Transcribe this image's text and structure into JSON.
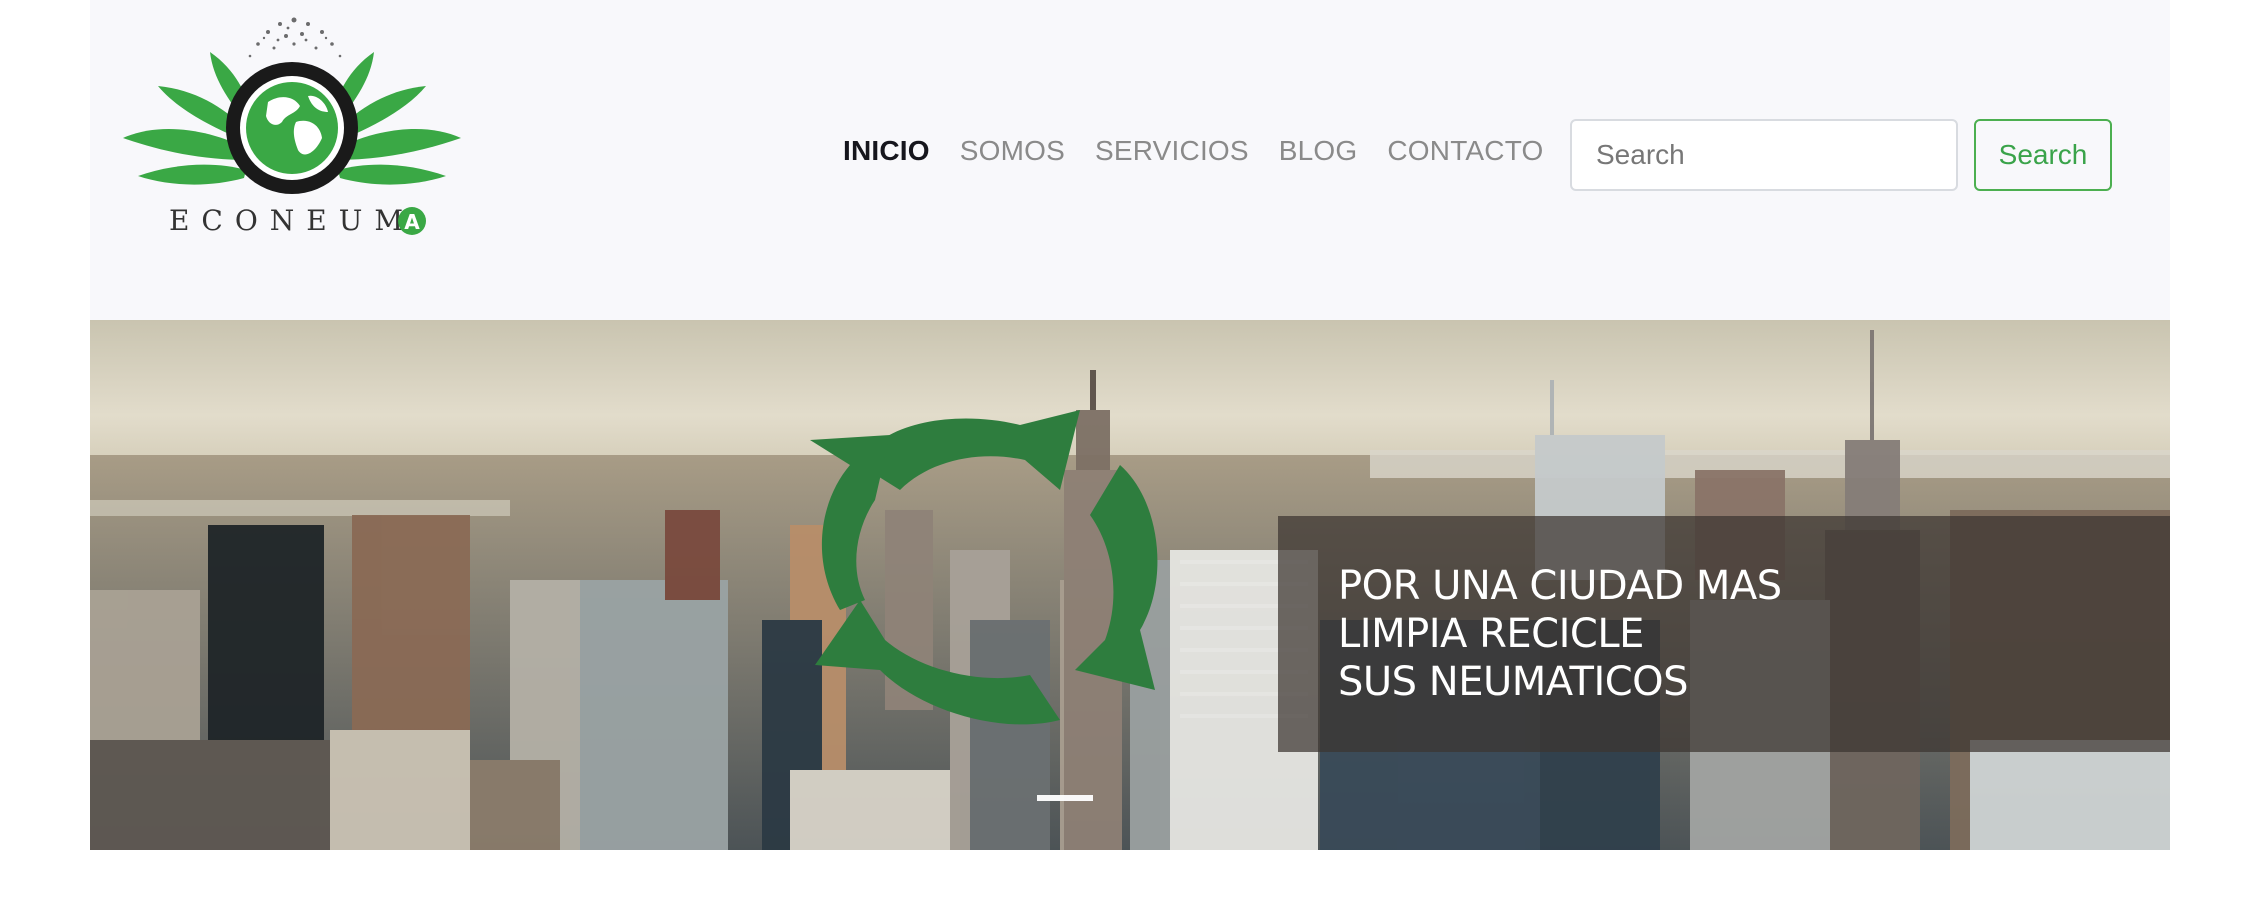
{
  "brand": {
    "name": "ECONEUMA",
    "logo_icon": "globe-tire-leaves-logo"
  },
  "nav": {
    "items": [
      {
        "label": "INICIO",
        "active": true
      },
      {
        "label": "SOMOS",
        "active": false
      },
      {
        "label": "SERVICIOS",
        "active": false
      },
      {
        "label": "BLOG",
        "active": false
      },
      {
        "label": "CONTACTO",
        "active": false
      }
    ]
  },
  "search": {
    "placeholder": "Search",
    "value": "",
    "button_label": "Search"
  },
  "hero": {
    "background": "city-skyline-photo",
    "icon": "recycle-arrows-icon",
    "caption_lines": [
      "POR UNA CIUDAD MAS",
      "LIMPIA RECICLE",
      "SUS NEUMATICOS"
    ],
    "active_slide": 1
  },
  "colors": {
    "accent_green": "#4caf50",
    "recycle_green": "#2e7d3e",
    "nav_active": "#16161d",
    "nav_inactive": "#8a8a8a",
    "navbar_bg": "#f8f8fb"
  }
}
